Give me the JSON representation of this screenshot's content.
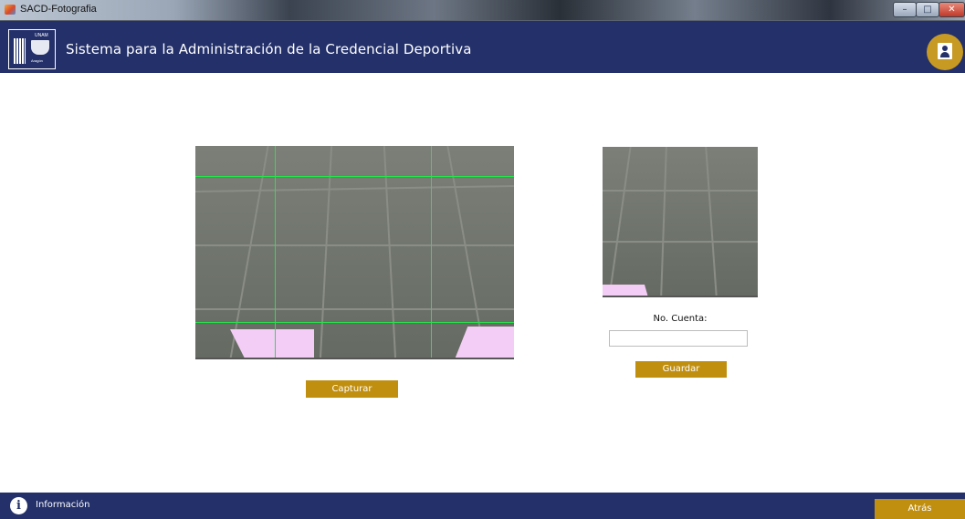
{
  "window": {
    "title": "SACD-Fotografia",
    "minimize": "–",
    "maximize": "□",
    "close": "✕"
  },
  "header": {
    "logo": {
      "top": "UNAM",
      "bottom": "Aragón"
    },
    "title": "Sistema para la Administración de la Credencial Deportiva",
    "profile_icon": "id-card-icon"
  },
  "camera": {
    "main_feed": "live-camera-preview",
    "thumb_feed": "captured-photo-preview",
    "capture_label": "Capturar"
  },
  "form": {
    "cuenta_label": "No. Cuenta:",
    "cuenta_value": "",
    "cuenta_placeholder": "",
    "save_label": "Guardar"
  },
  "footer": {
    "info_icon": "info-icon",
    "info_label": "Información",
    "back_label": "Atrás"
  },
  "colors": {
    "header_bg": "#23306a",
    "accent": "#c08f10",
    "guide_lines": "#25e34a"
  }
}
